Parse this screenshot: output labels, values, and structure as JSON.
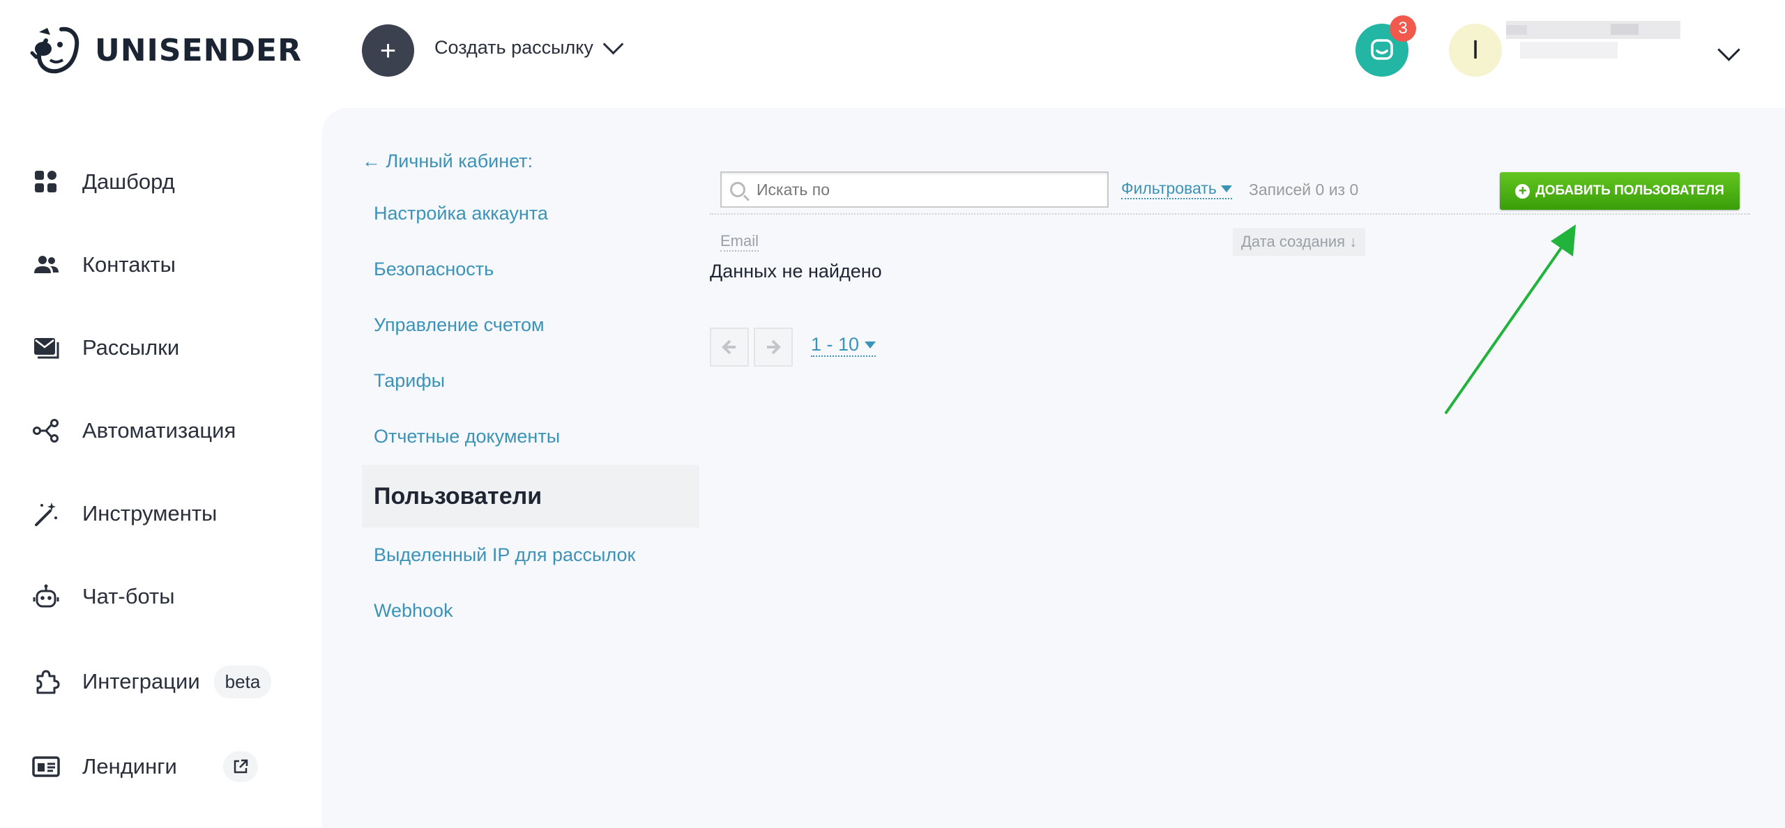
{
  "header": {
    "logo_text": "UNISENDER",
    "create_label": "Создать рассылку",
    "create_icon": "+",
    "chat_badge": "3",
    "avatar_letter": "I"
  },
  "sidebar": {
    "items": [
      {
        "label": "Дашборд",
        "icon": "dashboard-icon"
      },
      {
        "label": "Контакты",
        "icon": "contacts-icon"
      },
      {
        "label": "Рассылки",
        "icon": "mail-icon"
      },
      {
        "label": "Автоматизация",
        "icon": "automation-icon"
      },
      {
        "label": "Инструменты",
        "icon": "magic-wand-icon"
      },
      {
        "label": "Чат-боты",
        "icon": "robot-icon"
      },
      {
        "label": "Интеграции",
        "icon": "puzzle-icon",
        "badge": "beta"
      },
      {
        "label": "Лендинги",
        "icon": "landing-icon"
      }
    ]
  },
  "submenu": {
    "back_label": "← Личный кабинет:",
    "items": [
      "Настройка аккаунта",
      "Безопасность",
      "Управление счетом",
      "Тарифы",
      "Отчетные документы",
      "Пользователи",
      "Выделенный IP для рассылок",
      "Webhook"
    ],
    "active": "Пользователи"
  },
  "users": {
    "search_placeholder": "Искать по",
    "filter_label": "Фильтровать",
    "records": "Записей 0 из 0",
    "add_button": "ДОБАВИТЬ ПОЛЬЗОВАТЕЛЯ",
    "col_email": "Email",
    "col_date": "Дата создания ↓",
    "empty_text": "Данных не найдено",
    "page_range": "1 - 10"
  },
  "colors": {
    "accent": "#3b93b8",
    "add_button": "#4cae14",
    "chat": "#23b6a5",
    "badge": "#f0594c",
    "annotation_arrow": "#21b33b"
  }
}
